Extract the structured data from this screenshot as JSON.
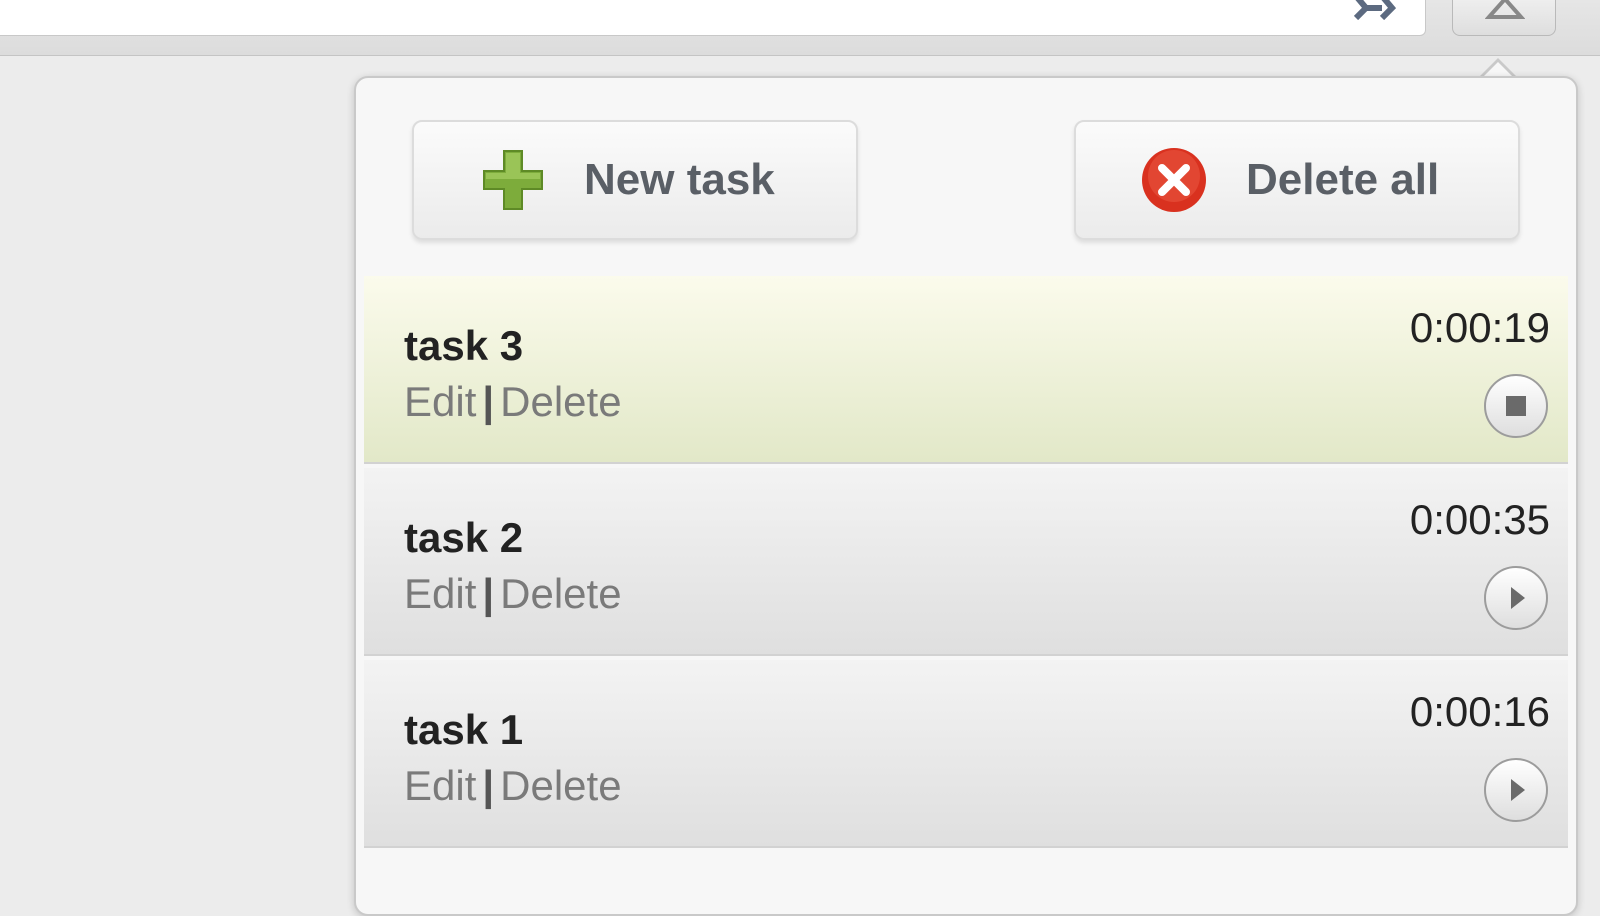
{
  "toolbar": {
    "new_task_label": "New task",
    "new_task_icon": "plus-icon",
    "delete_all_label": "Delete all",
    "delete_all_icon": "close-circle-icon"
  },
  "tasks": [
    {
      "name": "task 3",
      "time": "0:00:19",
      "edit": "Edit",
      "separator": "|",
      "delete": "Delete",
      "state": "running",
      "control_icon": "stop-icon"
    },
    {
      "name": "task 2",
      "time": "0:00:35",
      "edit": "Edit",
      "separator": "|",
      "delete": "Delete",
      "state": "paused",
      "control_icon": "play-icon"
    },
    {
      "name": "task 1",
      "time": "0:00:16",
      "edit": "Edit",
      "separator": "|",
      "delete": "Delete",
      "state": "paused",
      "control_icon": "play-icon"
    }
  ],
  "footer": {
    "text": ""
  },
  "colors": {
    "active_row": "#e2e8c8",
    "plus_green": "#7dac3b",
    "delete_red": "#d9311f"
  }
}
